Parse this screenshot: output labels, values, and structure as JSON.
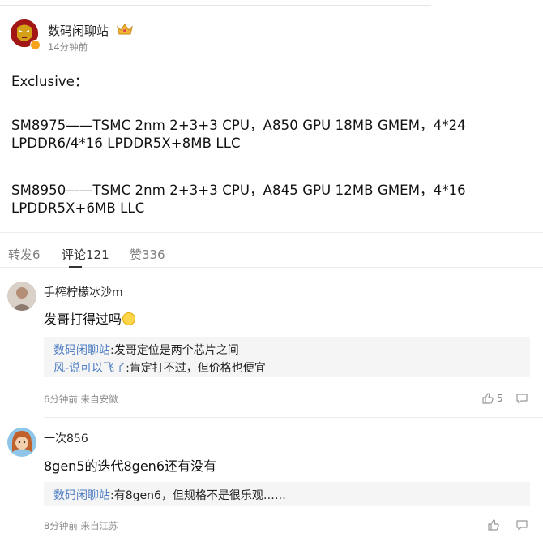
{
  "post": {
    "author": "数码闲聊站",
    "time": "14分钟前",
    "lines": [
      "Exclusive：",
      "SM8975——TSMC 2nm 2+3+3 CPU，A850 GPU 18MB GMEM，4*24",
      "LPDDR6/4*16 LPDDR5X+8MB LLC",
      "SM8950——TSMC 2nm 2+3+3 CPU，A845 GPU 12MB GMEM，4*16",
      "LPDDR5X+6MB LLC"
    ]
  },
  "tabs": {
    "repost": "转发6",
    "comments": "评论121",
    "likes": "赞336"
  },
  "comments": [
    {
      "name": "手榨柠檬冰沙m",
      "text": "发哥打得过吗",
      "replies": [
        {
          "author": "数码闲聊站",
          "body": ":发哥定位是两个芯片之间"
        },
        {
          "author": "风-说可以飞了",
          "body": ":肯定打不过，但价格也便宜"
        }
      ],
      "meta": "6分钟前 来自安徽",
      "likes": "5"
    },
    {
      "name": "一次856",
      "text": "8gen5的迭代8gen6还有没有",
      "replies": [
        {
          "author": "数码闲聊站",
          "body": ":有8gen6，但规格不是很乐观……"
        }
      ],
      "meta": "8分钟前 来自江苏",
      "likes": ""
    }
  ],
  "icons": {
    "avatar": "ironman-avatar",
    "badge": "verified-badge",
    "crown": "crown-icon",
    "like": "thumbs-up-icon",
    "comment": "comment-icon"
  },
  "colors": {
    "reply_author": "#4f7ec4",
    "badge": "#f7a41b"
  }
}
